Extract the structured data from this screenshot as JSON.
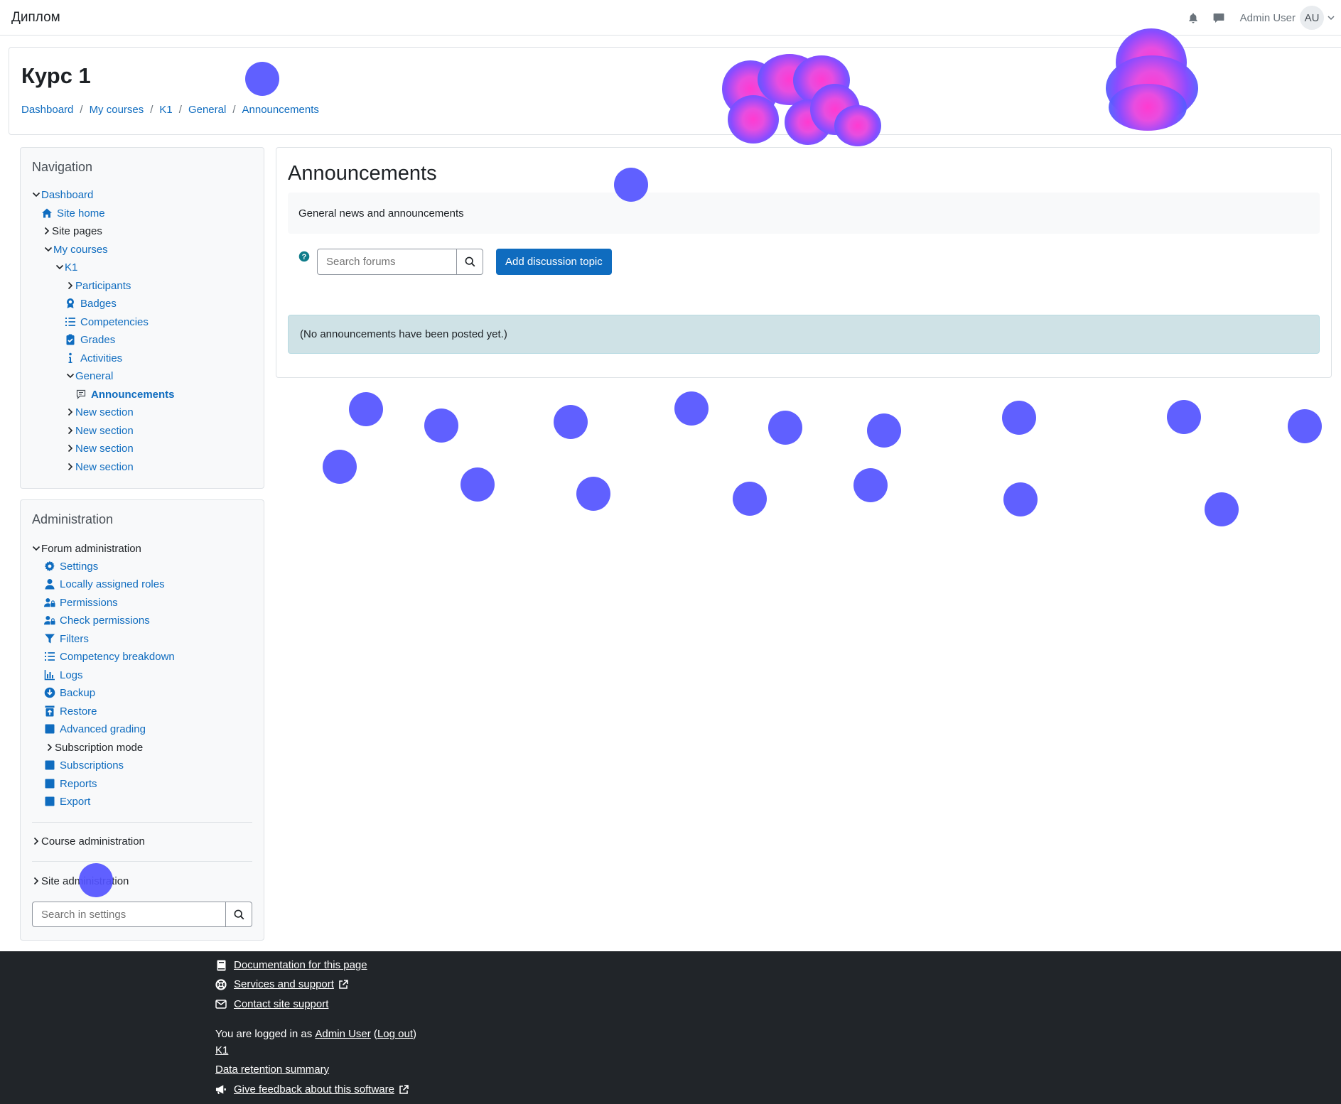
{
  "navbar": {
    "site_name": "Диплом",
    "user_name": "Admin User",
    "user_initials": "AU"
  },
  "header": {
    "title": "Курс 1",
    "breadcrumb": [
      "Dashboard",
      "My courses",
      "K1",
      "General",
      "Announcements"
    ]
  },
  "navigation": {
    "title": "Navigation",
    "items": [
      {
        "label": "Dashboard"
      },
      {
        "label": "Site home"
      },
      {
        "label": "Site pages"
      },
      {
        "label": "My courses"
      },
      {
        "label": "K1"
      },
      {
        "label": "Participants"
      },
      {
        "label": "Badges"
      },
      {
        "label": "Competencies"
      },
      {
        "label": "Grades"
      },
      {
        "label": "Activities"
      },
      {
        "label": "General"
      },
      {
        "label": "Announcements"
      },
      {
        "label": "New section"
      },
      {
        "label": "New section"
      },
      {
        "label": "New section"
      },
      {
        "label": "New section"
      }
    ]
  },
  "administration": {
    "title": "Administration",
    "items": [
      {
        "label": "Forum administration"
      },
      {
        "label": "Settings"
      },
      {
        "label": "Locally assigned roles"
      },
      {
        "label": "Permissions"
      },
      {
        "label": "Check permissions"
      },
      {
        "label": "Filters"
      },
      {
        "label": "Competency breakdown"
      },
      {
        "label": "Logs"
      },
      {
        "label": "Backup"
      },
      {
        "label": "Restore"
      },
      {
        "label": "Advanced grading"
      },
      {
        "label": "Subscription mode"
      },
      {
        "label": "Subscriptions"
      },
      {
        "label": "Reports"
      },
      {
        "label": "Export"
      }
    ],
    "course_admin": "Course administration",
    "site_admin": "Site administration",
    "search_placeholder": "Search in settings"
  },
  "main": {
    "title": "Announcements",
    "intro": "General news and announcements",
    "search_placeholder": "Search forums",
    "add_button": "Add discussion topic",
    "notice": "(No announcements have been posted yet.)"
  },
  "footer": {
    "documentation": "Documentation for this page",
    "services": "Services and support",
    "contact": "Contact site support",
    "logged_in_prefix": "You are logged in as",
    "logged_user": "Admin User",
    "logout": "Log out",
    "course_link": "K1",
    "data_retention": "Data retention summary",
    "feedback": "Give feedback about this software"
  },
  "colors": {
    "primary": "#0f6cbf",
    "footer_bg": "#212529",
    "notice_bg": "#cfe2e6",
    "heat_dot": "#5252ff",
    "heat_hot": "#ff3ad0"
  },
  "icons": [
    "bell-icon",
    "chat-icon",
    "chevron-down-icon",
    "home-icon",
    "badge-icon",
    "list-icon",
    "clipboard-icon",
    "info-icon",
    "forum-icon",
    "gear-icon",
    "user-icon",
    "users-lock-icon",
    "filter-icon",
    "chart-icon",
    "download-icon",
    "upload-icon",
    "square-icon",
    "search-icon",
    "help-icon",
    "book-icon",
    "lifebuoy-icon",
    "envelope-icon",
    "megaphone-icon",
    "external-link-icon"
  ]
}
